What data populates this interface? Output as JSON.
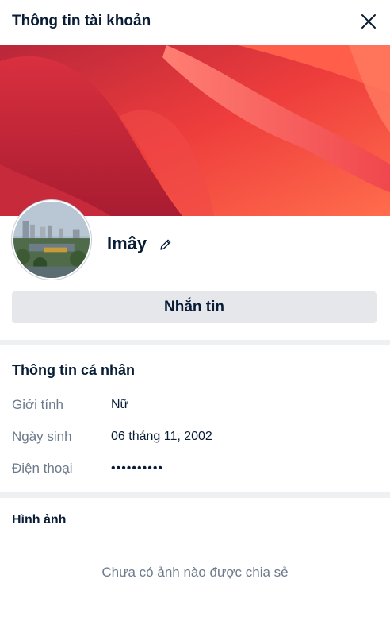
{
  "header": {
    "title": "Thông tin tài khoản",
    "close_icon": "close-icon"
  },
  "cover": {
    "icon": "cover-photo",
    "colors": [
      "#c8223a",
      "#f03f3a",
      "#ff6a4a",
      "#e83545"
    ]
  },
  "profile": {
    "avatar_icon": "avatar-city-photo",
    "name": "Imây",
    "edit_icon": "pencil-icon"
  },
  "actions": {
    "message_label": "Nhắn tin"
  },
  "personal_info": {
    "title": "Thông tin cá nhân",
    "fields": [
      {
        "label": "Giới tính",
        "value": "Nữ"
      },
      {
        "label": "Ngày sinh",
        "value": "06 tháng 11, 2002"
      },
      {
        "label": "Điện thoại",
        "value": "••••••••••"
      }
    ]
  },
  "photos": {
    "title": "Hình ảnh",
    "empty_text": "Chưa có ảnh nào được chia sẻ"
  }
}
